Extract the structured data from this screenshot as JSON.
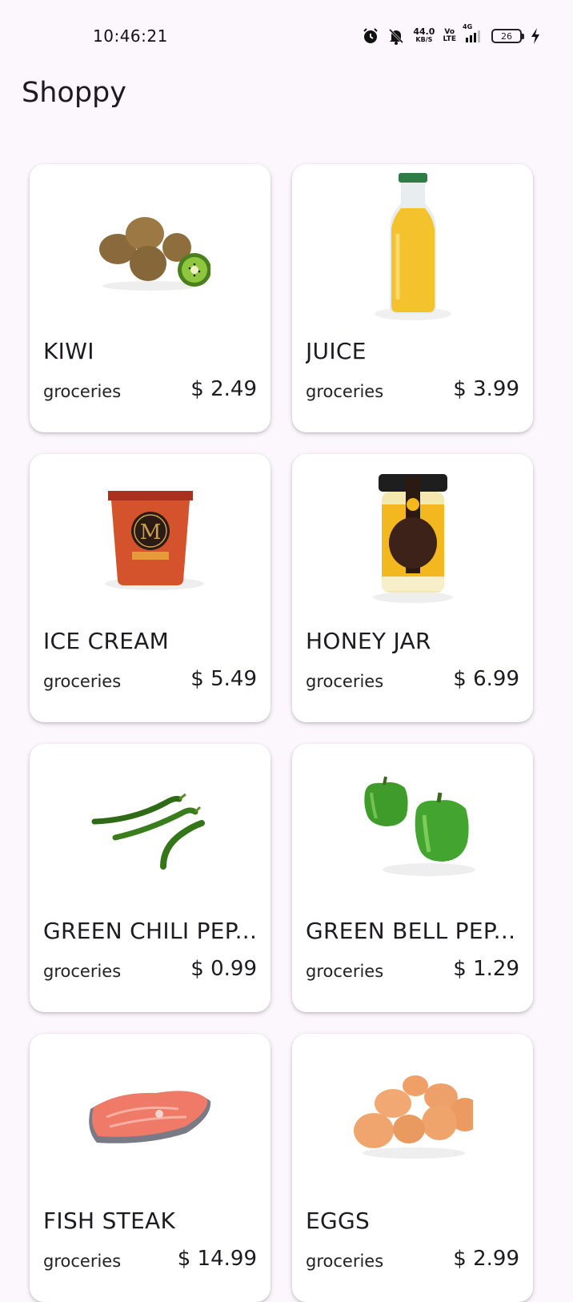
{
  "status_bar": {
    "time": "10:46:21",
    "net_speed_value": "44.0",
    "net_speed_unit": "KB/S",
    "volte_top": "Vo",
    "volte_bottom": "LTE",
    "network": "4G",
    "battery": "26",
    "icons": [
      "alarm-icon",
      "mute-bell-icon",
      "signal-icon",
      "charging-bolt-icon"
    ]
  },
  "app": {
    "title": "Shoppy"
  },
  "products": [
    {
      "name": "KIWI",
      "category": "groceries",
      "price": "$ 2.49",
      "icon": "kiwi-image"
    },
    {
      "name": "JUICE",
      "category": "groceries",
      "price": "$ 3.99",
      "icon": "juice-bottle-image"
    },
    {
      "name": "ICE CREAM",
      "category": "groceries",
      "price": "$ 5.49",
      "icon": "ice-cream-tub-image"
    },
    {
      "name": "HONEY JAR",
      "category": "groceries",
      "price": "$ 6.99",
      "icon": "honey-jar-image"
    },
    {
      "name": "GREEN CHILI PEP...",
      "category": "groceries",
      "price": "$ 0.99",
      "icon": "green-chili-image"
    },
    {
      "name": "GREEN BELL PEP...",
      "category": "groceries",
      "price": "$ 1.29",
      "icon": "bell-pepper-image"
    },
    {
      "name": "FISH STEAK",
      "category": "groceries",
      "price": "$ 14.99",
      "icon": "fish-steak-image"
    },
    {
      "name": "EGGS",
      "category": "groceries",
      "price": "$ 2.99",
      "icon": "eggs-image"
    }
  ],
  "colors": {
    "background": "#fcf6fd",
    "card": "#ffffff",
    "text": "#1d1b20"
  }
}
